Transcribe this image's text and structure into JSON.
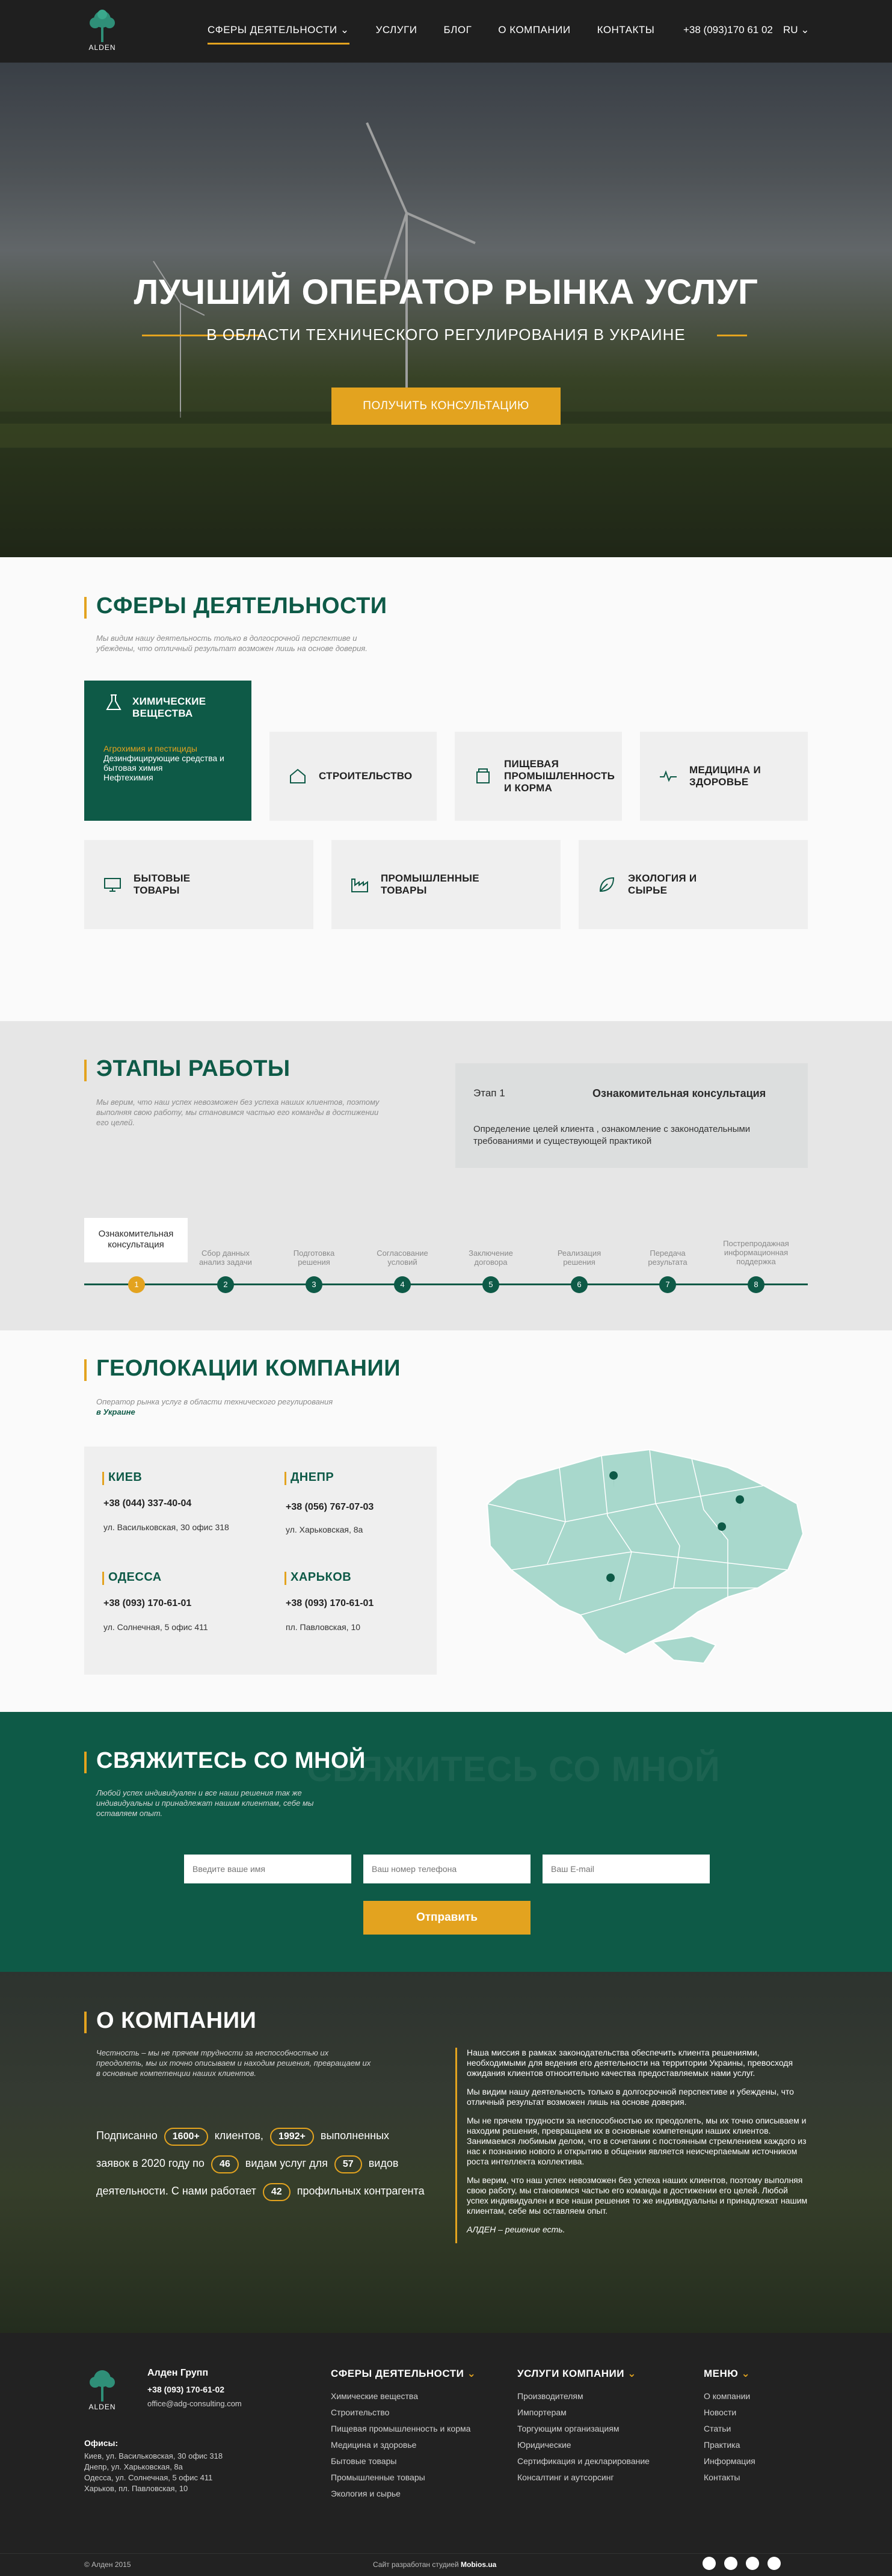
{
  "header": {
    "logo_text": "ALDEN",
    "nav": [
      {
        "label": "СФЕРЫ ДЕЯТЕЛЬНОСТИ",
        "active": true
      },
      {
        "label": "УСЛУГИ"
      },
      {
        "label": "БЛОГ"
      },
      {
        "label": "О КОМПАНИИ"
      },
      {
        "label": "КОНТАКТЫ"
      }
    ],
    "phone": "+38 (093)170 61 02",
    "lang": "RU"
  },
  "hero": {
    "title": "ЛУЧШИЙ ОПЕРАТОР РЫНКА УСЛУГ",
    "subtitle": "В ОБЛАСТИ ТЕХНИЧЕСКОГО РЕГУЛИРОВАНИЯ В УКРАИНЕ",
    "button": "ПОЛУЧИТЬ КОНСУЛЬТАЦИЮ"
  },
  "spheres": {
    "title": "СФЕРЫ ДЕЯТЕЛЬНОСТИ",
    "desc": "Мы видим нашу деятельность только в долгосрочной перспективе и убеждены, что отличный результат возможен лишь на основе доверия.",
    "main_card": {
      "label": "ХИМИЧЕСКИЕ ВЕЩЕСТВА",
      "sub": [
        "Агрохимия и пестициды",
        "Дезинфицирующие средства и бытовая химия",
        "Нефтехимия"
      ]
    },
    "row1": [
      "СТРОИТЕЛЬСТВО",
      "ПИЩЕВАЯ ПРОМЫШЛЕННОСТЬ И КОРМА",
      "МЕДИЦИНА И ЗДОРОВЬЕ"
    ],
    "row2": [
      "БЫТОВЫЕ ТОВАРЫ",
      "ПРОМЫШЛЕННЫЕ ТОВАРЫ",
      "ЭКОЛОГИЯ И СЫРЬЕ"
    ]
  },
  "stages": {
    "title": "ЭТАПЫ РАБОТЫ",
    "desc": "Мы верим, что наш успех невозможен без успеха наших клиентов, поэтому выполняя свою работу, мы становимся частью его команды в достижении его целей.",
    "box_num": "Этап 1",
    "box_name": "Ознакомительная консультация",
    "box_text": "Определение целей клиента , ознакомление с законодательными требованиями и существующей практикой",
    "active_label": "Ознакомительная консультация",
    "labels": [
      "Сбор данных анализ задачи",
      "Подготовка решения",
      "Согласование условий",
      "Заключение договора",
      "Реализация решения",
      "Передача результата",
      "Пострепродажная информационная поддержка"
    ],
    "numbers": [
      "1",
      "2",
      "3",
      "4",
      "5",
      "6",
      "7",
      "8"
    ]
  },
  "geo": {
    "title": "ГЕОЛОКАЦИИ КОМПАНИИ",
    "desc_1": "Оператор рынка услуг в области технического регулирования",
    "desc_2": "в Украине",
    "offices": [
      {
        "city": "КИЕВ",
        "phone": "+38 (044) 337-40-04",
        "addr": "ул. Васильковская, 30 офис 318"
      },
      {
        "city": "ДНЕПР",
        "phone": "+38 (056) 767-07-03",
        "addr": "ул. Харьковская, 8а"
      },
      {
        "city": "ОДЕССА",
        "phone": "+38 (093) 170-61-01",
        "addr": "ул. Солнечная, 5 офис 411"
      },
      {
        "city": "ХАРЬКОВ",
        "phone": "+38 (093) 170-61-01",
        "addr": "пл. Павловская, 10"
      }
    ]
  },
  "contact": {
    "title": "СВЯЖИТЕСЬ СО МНОЙ",
    "ghost": "СВЯЖИТЕСЬ СО МНОЙ",
    "desc": "Любой успех индивидуален и все наши решения так же индивидуальны и принадлежат нашим клиентам, себе мы оставляем опыт.",
    "name_placeholder": "Введите ваше имя",
    "phone_placeholder": "Ваш номер телефона",
    "email_placeholder": "Ваш E-mail",
    "button": "Отправить"
  },
  "about": {
    "title": "О КОМПАНИИ",
    "desc": "Честность – мы не прячем трудности за неспособностью их преодолеть, мы их точно описываем и находим решения, превращаем их в основные компетенции наших клиентов.",
    "stats": {
      "t1": "Подписанно",
      "v1": "1600+",
      "t2": "клиентов,",
      "v2": "1992+",
      "t3": "выполненных",
      "t4": "заявок в 2020 году по",
      "v3": "46",
      "t5": "видам услуг для",
      "v4": "57",
      "t6": "видов",
      "t7": "деятельности. С нами работает",
      "v5": "42",
      "t8": "профильных контрагента"
    },
    "p1": "Наша миссия в рамках законодательства обеспечить клиента решениями, необходимыми для ведения его деятельности на территории Украины, превосходя ожидания клиентов относительно качества предоставляемых нами услуг.",
    "p2": "Мы видим нашу деятельность только в долгосрочной перспективе и убеждены, что отличный результат возможен лишь на основе доверия.",
    "p3": "Мы не прячем трудности за неспособностью их преодолеть, мы их точно описываем и находим решения, превращаем их в основные компетенции наших клиентов. Занимаемся любимым делом, что в сочетании с постоянным стремлением каждого из нас к познанию нового и открытию в общении является неисчерпаемым источником роста интеллекта коллектива.",
    "p4": "Мы верим, что наш успех невозможен без успеха наших клиентов, поэтому выполняя свою работу, мы становимся частью его команды в достижении его целей. Любой успех индивидуален и все наши решения то же индивидуальны и принадлежат нашим клиентам, себе мы оставляем опыт.",
    "p5": "АЛДЕН – решение есть."
  },
  "footer": {
    "logo_text": "ALDEN",
    "company": "Алден Групп",
    "phone": "+38 (093) 170-61-02",
    "email": "office@adg-consulting.com",
    "offices_title": "Офисы:",
    "offices": [
      "Киев, ул. Васильковская, 30 офис 318",
      "Днепр, ул. Харьковская, 8а",
      "Одесса, ул. Солнечная, 5 офис 411",
      "Харьков, пл. Павловская, 10"
    ],
    "col1_title": "СФЕРЫ ДЕЯТЕЛЬНОСТИ",
    "col1": [
      "Химические вещества",
      "Строительство",
      "Пищевая промышленность и корма",
      "Медицина и здоровье",
      "Бытовые товары",
      "Промышленные товары",
      "Экология и сырье"
    ],
    "col2_title": "УСЛУГИ КОМПАНИИ",
    "col2": [
      "Производителям",
      "Импортерам",
      "Торгующим организациям",
      "Юридические",
      "Сертификация и декларирование",
      "Консалтинг и аутсорсинг"
    ],
    "col3_title": "МЕНЮ",
    "col3": [
      "О компании",
      "Новости",
      "Статьи",
      "Практика",
      "Информация",
      "Контакты"
    ],
    "copyright": "© Алден 2015",
    "dev": "Сайт разработан студией",
    "dev_name": "Mobios.ua"
  },
  "colors": {
    "brand_green": "#0e5a47",
    "accent_orange": "#e3a31f",
    "map_green": "#a8d8cc"
  }
}
